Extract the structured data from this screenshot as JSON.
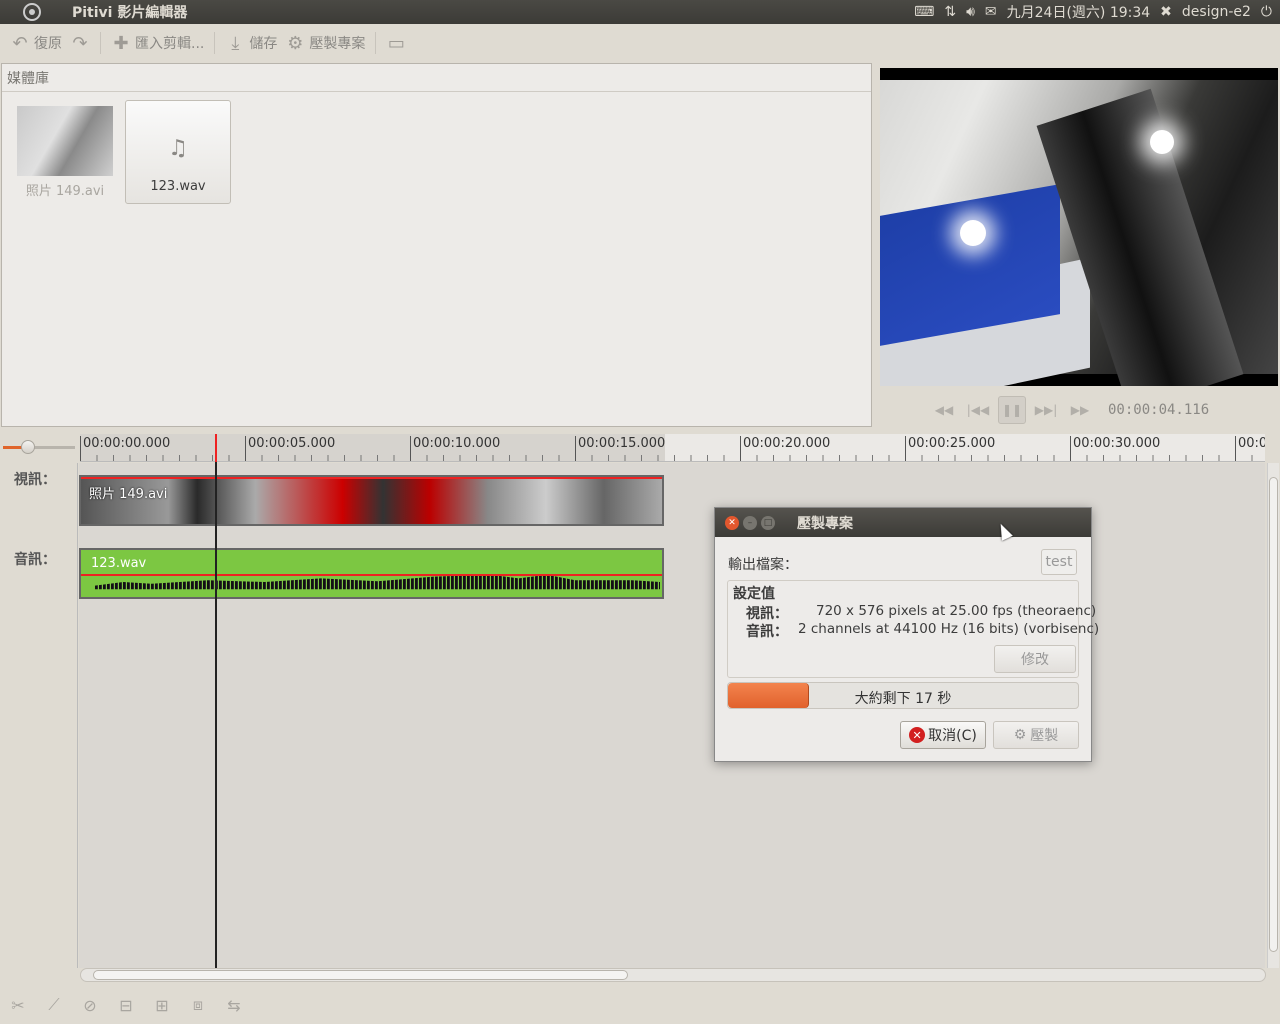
{
  "topbar": {
    "app_title": "Pitivi 影片編輯器",
    "datetime": "九月24日(週六) 19:34",
    "user": "design-e2"
  },
  "toolbar": {
    "undo_label": "復原",
    "import_label": "匯入剪輯...",
    "save_label": "儲存",
    "render_label": "壓製專案"
  },
  "library": {
    "header": "媒體庫",
    "items": [
      {
        "label": "照片 149.avi",
        "type": "video"
      },
      {
        "label": "123.wav",
        "type": "audio"
      }
    ]
  },
  "viewer": {
    "timecode": "00:00:04.116"
  },
  "ruler": {
    "ticks": [
      "00:00:00.000",
      "00:00:05.000",
      "00:00:10.000",
      "00:00:15.000",
      "00:00:20.000",
      "00:00:25.000",
      "00:00:30.000",
      "00:0("
    ]
  },
  "timeline": {
    "video_track_label": "視訊：",
    "audio_track_label": "音訊：",
    "video_clip": "照片 149.avi",
    "audio_clip": "123.wav"
  },
  "dialog": {
    "title": "壓製專案",
    "output_label": "輸出檔案：",
    "output_value": "test",
    "settings_title": "設定值",
    "video_label": "視訊：",
    "video_value": "720 x 576 pixels at 25.00 fps (theoraenc)",
    "audio_label": "音訊：",
    "audio_value": "2 channels at 44100 Hz (16 bits) (vorbisenc)",
    "modify_label": "修改",
    "progress_text": "大約剩下 17 秒",
    "progress_fraction": 0.23,
    "cancel_label": "取消(C)",
    "render_label": "壓製"
  },
  "colors": {
    "accent": "#e1612c",
    "audio_clip": "#7cc742",
    "panel": "#3c3b37"
  }
}
